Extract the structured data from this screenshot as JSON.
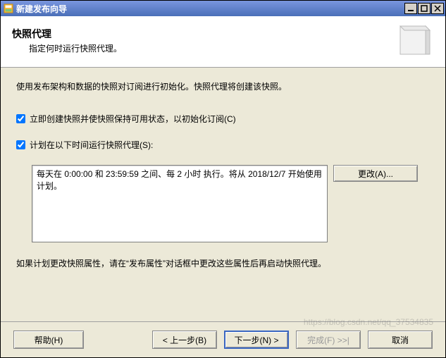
{
  "window": {
    "title": "新建发布向导"
  },
  "header": {
    "title": "快照代理",
    "subtitle": "指定何时运行快照代理。"
  },
  "content": {
    "intro": "使用发布架构和数据的快照对订阅进行初始化。快照代理将创建该快照。",
    "checkbox1_label": "立即创建快照并使快照保持可用状态，以初始化订阅(C)",
    "checkbox2_label": "计划在以下时间运行快照代理(S):",
    "schedule_text": "每天在 0:00:00 和 23:59:59 之间、每 2 小时 执行。将从 2018/12/7 开始使用计划。",
    "change_button": "更改(A)...",
    "note": "如果计划更改快照属性，请在“发布属性”对话框中更改这些属性后再启动快照代理。"
  },
  "buttons": {
    "help": "帮助(H)",
    "back": "< 上一步(B)",
    "next": "下一步(N) >",
    "finish": "完成(F) >>|",
    "cancel": "取消"
  },
  "watermark": "https://blog.csdn.net/qq_37534835"
}
